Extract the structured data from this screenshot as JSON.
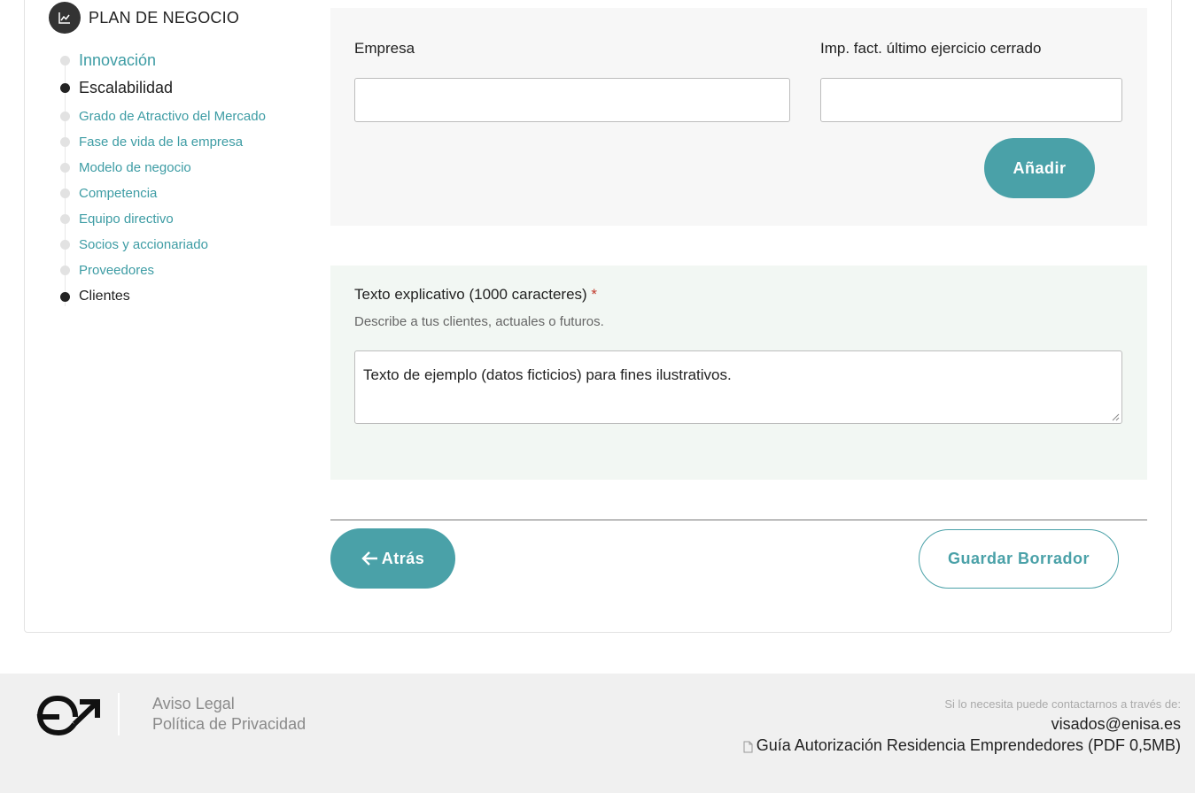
{
  "section": {
    "title": "PLAN DE NEGOCIO",
    "icon": "chart-line-icon"
  },
  "steps": [
    {
      "label": "Innovación",
      "state": "done"
    },
    {
      "label": "Escalabilidad",
      "state": "current"
    },
    {
      "label": "Grado de Atractivo del Mercado",
      "state": "done"
    },
    {
      "label": "Fase de vida de la empresa",
      "state": "done"
    },
    {
      "label": "Modelo de negocio",
      "state": "done"
    },
    {
      "label": "Competencia",
      "state": "done"
    },
    {
      "label": "Equipo directivo",
      "state": "done"
    },
    {
      "label": "Socios y accionariado",
      "state": "done"
    },
    {
      "label": "Proveedores",
      "state": "done"
    },
    {
      "label": "Clientes",
      "state": "current"
    }
  ],
  "form": {
    "empresa_label": "Empresa",
    "empresa_value": "",
    "facturacion_label": "Imp. fact. último ejercicio cerrado",
    "facturacion_value": "",
    "add_button": "Añadir",
    "texto_label": "Texto explicativo (1000 caracteres)",
    "required_mark": "*",
    "texto_help": "Describe a tus clientes, actuales o futuros.",
    "texto_value": "Texto de ejemplo (datos ficticios) para fines ilustrativos."
  },
  "actions": {
    "back_label": "Atrás",
    "draft_label": "Guardar Borrador"
  },
  "footer": {
    "logo_icon": "enisa-logo",
    "legal_link": "Aviso Legal",
    "privacy_link": "Política de Privacidad",
    "contact_note": "Si lo necesita puede contactarnos a través de:",
    "email": "visados@enisa.es",
    "guide_link": "Guía Autorización Residencia Emprendedores (PDF 0,5MB)",
    "guide_icon": "document-icon"
  },
  "colors": {
    "accent": "#4aa1a8",
    "panel_gray": "#f7f7f7",
    "panel_green": "#f2f7f3",
    "required": "#c0392b"
  }
}
